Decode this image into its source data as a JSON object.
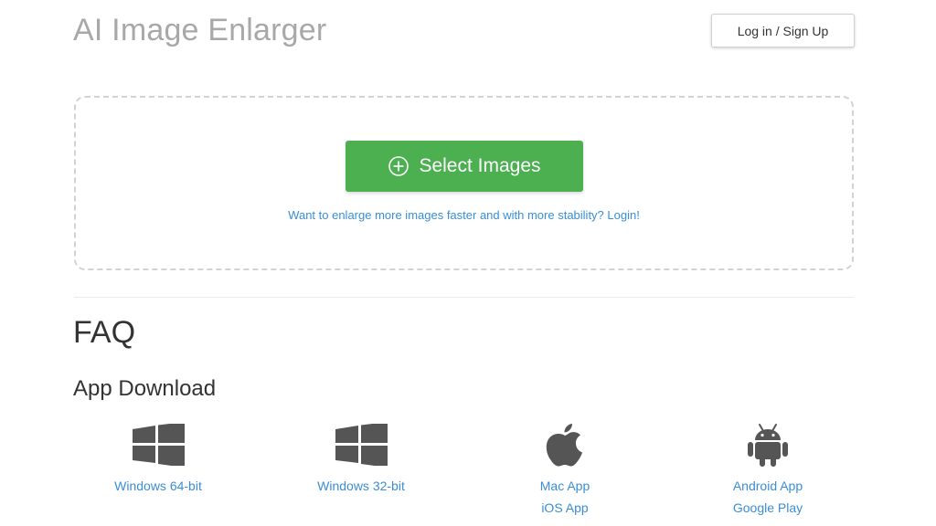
{
  "header": {
    "title": "AI Image Enlarger",
    "login_label": "Log in / Sign Up"
  },
  "upload": {
    "select_label": "Select Images",
    "select_icon": "plus-circle-icon",
    "hint": "Want to enlarge more images faster and with more stability? Login!"
  },
  "faq": {
    "title": "FAQ"
  },
  "apps": {
    "title": "App Download",
    "items": [
      {
        "icon": "windows-icon",
        "links": [
          "Windows 64-bit"
        ]
      },
      {
        "icon": "windows-icon",
        "links": [
          "Windows 32-bit"
        ]
      },
      {
        "icon": "apple-icon",
        "links": [
          "Mac App",
          "iOS App"
        ]
      },
      {
        "icon": "android-icon",
        "links": [
          "Android App",
          "Google Play"
        ]
      }
    ]
  },
  "colors": {
    "accent_green": "#4caf50",
    "link_blue": "#3a8ed6",
    "title_gray": "#a8a8a8",
    "icon_gray": "#555555"
  }
}
